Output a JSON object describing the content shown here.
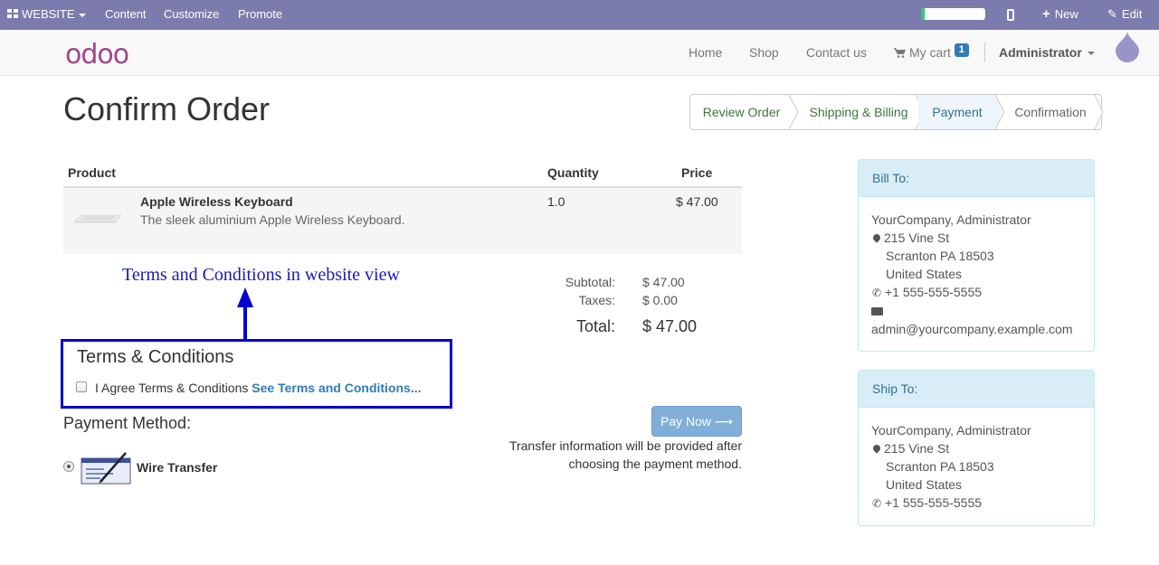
{
  "adminbar": {
    "website_label": "WEBSITE",
    "menu": [
      "Content",
      "Customize",
      "Promote"
    ],
    "progress_fraction": 0.06,
    "new_label": "New",
    "edit_label": "Edit",
    "bar_color": "#7c7bad"
  },
  "navbar": {
    "logo_text": "odoo",
    "links": [
      "Home",
      "Shop",
      "Contact us"
    ],
    "cart_label": "My cart",
    "cart_count": "1",
    "user_label": "Administrator"
  },
  "page": {
    "title": "Confirm Order"
  },
  "wizard": {
    "steps": [
      "Review Order",
      "Shipping & Billing",
      "Payment",
      "Confirmation"
    ]
  },
  "cart_table": {
    "headers": [
      "Product",
      "Quantity",
      "Price"
    ],
    "rows": [
      {
        "name": "Apple Wireless Keyboard",
        "description": "The sleek aluminium Apple Wireless Keyboard.",
        "quantity": "1.0",
        "price": "$ 47.00"
      }
    ]
  },
  "annotation": {
    "text": "Terms and Conditions in website view",
    "color": "#0000d0"
  },
  "terms": {
    "title": "Terms & Conditions",
    "agree_text": "I Agree Terms & Conditions",
    "link_text": "See Terms and Conditions..."
  },
  "totals": {
    "subtotal_label": "Subtotal:",
    "subtotal_value": "$ 47.00",
    "taxes_label": "Taxes:",
    "taxes_value": "$ 0.00",
    "total_label": "Total:",
    "total_value": "$ 47.00"
  },
  "payment": {
    "title": "Payment Method:",
    "method": "Wire Transfer",
    "pay_button": "Pay Now",
    "transfer_line1": "Transfer information will be provided after",
    "transfer_line2": "choosing the payment method."
  },
  "bill_to": {
    "heading": "Bill To:",
    "name": "YourCompany, Administrator",
    "street": "215 Vine St",
    "city": "Scranton PA 18503",
    "country": "United States",
    "phone": "+1 555-555-5555",
    "email": "admin@yourcompany.example.com"
  },
  "ship_to": {
    "heading": "Ship To:",
    "name": "YourCompany, Administrator",
    "street": "215 Vine St",
    "city": "Scranton PA 18503",
    "country": "United States",
    "phone": "+1 555-555-5555"
  }
}
